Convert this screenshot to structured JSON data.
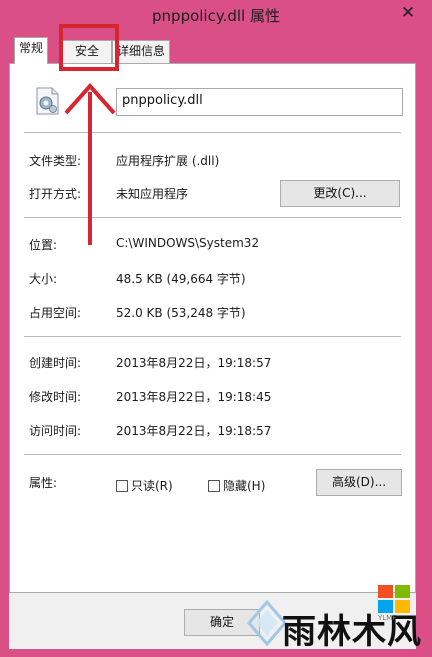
{
  "window": {
    "title": "pnppolicy.dll 属性",
    "close_glyph": "✕"
  },
  "tabs": [
    {
      "label": "常规",
      "active": true
    },
    {
      "label": "安全",
      "active": false
    },
    {
      "label": "详细信息",
      "active": false
    }
  ],
  "general": {
    "file_name": "pnppolicy.dll",
    "file_type_label": "文件类型:",
    "file_type_value": "应用程序扩展 (.dll)",
    "opens_with_label": "打开方式:",
    "opens_with_value": "未知应用程序",
    "change_button": "更改(C)...",
    "location_label": "位置:",
    "location_value": "C:\\WINDOWS\\System32",
    "size_label": "大小:",
    "size_value": "48.5 KB (49,664 字节)",
    "size_on_disk_label": "占用空间:",
    "size_on_disk_value": "52.0 KB (53,248 字节)",
    "created_label": "创建时间:",
    "created_value": "2013年8月22日，19:18:57",
    "modified_label": "修改时间:",
    "modified_value": "2013年8月22日，19:18:45",
    "accessed_label": "访问时间:",
    "accessed_value": "2013年8月22日，19:18:57",
    "attributes_label": "属性:",
    "readonly_label": "只读(R)",
    "readonly_checked": false,
    "hidden_label": "隐藏(H)",
    "hidden_checked": false,
    "advanced_button": "高级(D)..."
  },
  "footer": {
    "ok_button": "确定"
  },
  "watermark": {
    "text": "雨林木风",
    "sub": "YLMF"
  },
  "colors": {
    "background": "#d94f86",
    "annotation": "#d6262f"
  }
}
